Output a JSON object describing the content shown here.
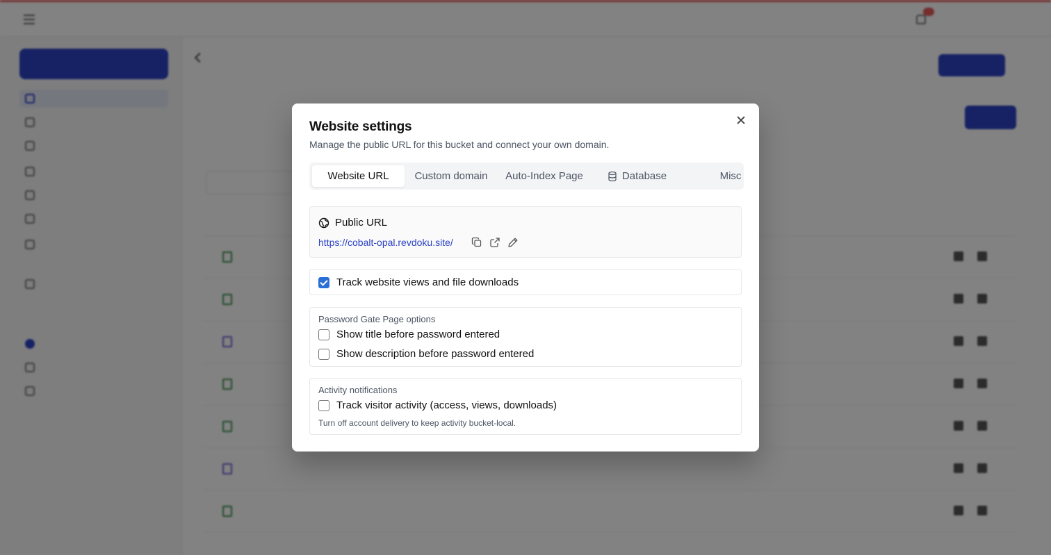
{
  "modal": {
    "title": "Website settings",
    "subtitle": "Manage the public URL for this bucket and connect your own domain.",
    "tabs": [
      {
        "label": "Website URL",
        "active": true
      },
      {
        "label": "Custom domain",
        "active": false
      },
      {
        "label": "Auto-Index Page",
        "active": false
      },
      {
        "label": "Database",
        "active": false,
        "icon": "database-icon"
      },
      {
        "label": "Misc",
        "active": false
      }
    ],
    "public_url": {
      "heading": "Public URL",
      "icon": "globe-icon",
      "url": "https://cobalt-opal.revdoku.site/",
      "actions": [
        "copy-icon",
        "open-external-icon",
        "edit-pencil-icon"
      ]
    },
    "track_views": {
      "label": "Track website views and file downloads",
      "checked": true
    },
    "password_gate": {
      "title": "Password Gate Page options",
      "options": [
        {
          "label": "Show title before password entered",
          "checked": false
        },
        {
          "label": "Show description before password entered",
          "checked": false
        }
      ]
    },
    "activity": {
      "title": "Activity notifications",
      "option": {
        "label": "Track visitor activity (access, views, downloads)",
        "checked": false
      },
      "help": "Turn off account delivery to keep activity bucket-local."
    }
  },
  "colors": {
    "accent": "#2b43c4",
    "link": "#2b43c4",
    "checkbox": "#2b6fd6",
    "overlay": "rgba(0,0,0,0.49)"
  }
}
